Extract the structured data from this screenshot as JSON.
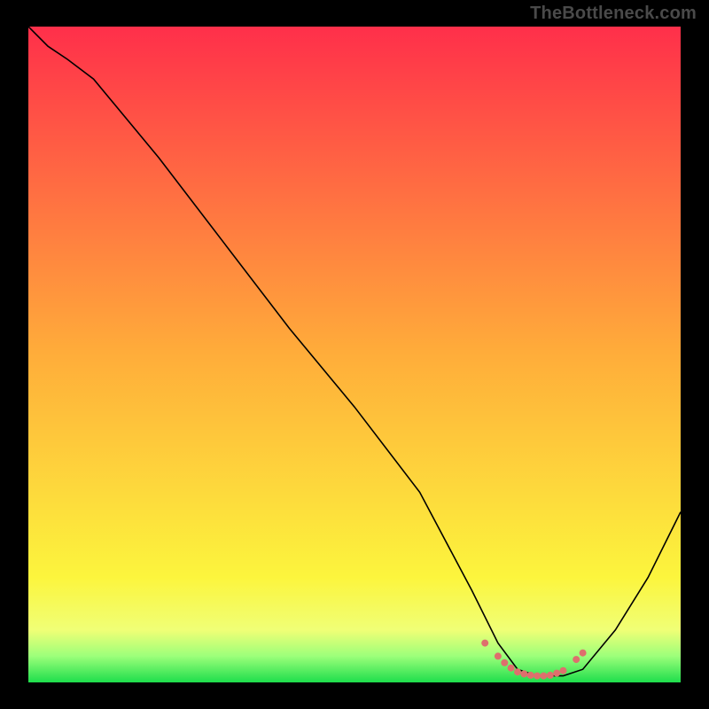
{
  "watermark": "TheBottleneck.com",
  "gradient_stops": [
    {
      "id": "g0",
      "offset": "0%",
      "color": "#ff2f4a"
    },
    {
      "id": "g1",
      "offset": "50%",
      "color": "#ffad3a"
    },
    {
      "id": "g2",
      "offset": "84%",
      "color": "#fcf53d"
    },
    {
      "id": "g3",
      "offset": "92%",
      "color": "#f0ff76"
    },
    {
      "id": "g4",
      "offset": "96%",
      "color": "#9cff7a"
    },
    {
      "id": "g5",
      "offset": "100%",
      "color": "#1ede4c"
    }
  ],
  "dot_color": "#de6f6d",
  "chart_data": {
    "type": "line",
    "title": "",
    "xlabel": "",
    "ylabel": "",
    "xlim": [
      0,
      100
    ],
    "ylim": [
      0,
      100
    ],
    "grid": false,
    "series": [
      {
        "name": "bottleneck-curve",
        "x": [
          0,
          3,
          6,
          10,
          20,
          30,
          40,
          50,
          60,
          68,
          72,
          75,
          78,
          82,
          85,
          90,
          95,
          100
        ],
        "y": [
          100,
          97,
          95,
          92,
          80,
          67,
          54,
          42,
          29,
          14,
          6,
          2,
          1,
          1,
          2,
          8,
          16,
          26
        ]
      }
    ],
    "optimal_dots": {
      "x": [
        70,
        72,
        73,
        74,
        75,
        76,
        77,
        78,
        79,
        80,
        81,
        82,
        84,
        85
      ],
      "y": [
        6,
        4,
        3,
        2.2,
        1.6,
        1.3,
        1.1,
        1.0,
        1.0,
        1.1,
        1.4,
        1.8,
        3.5,
        4.5
      ]
    }
  }
}
